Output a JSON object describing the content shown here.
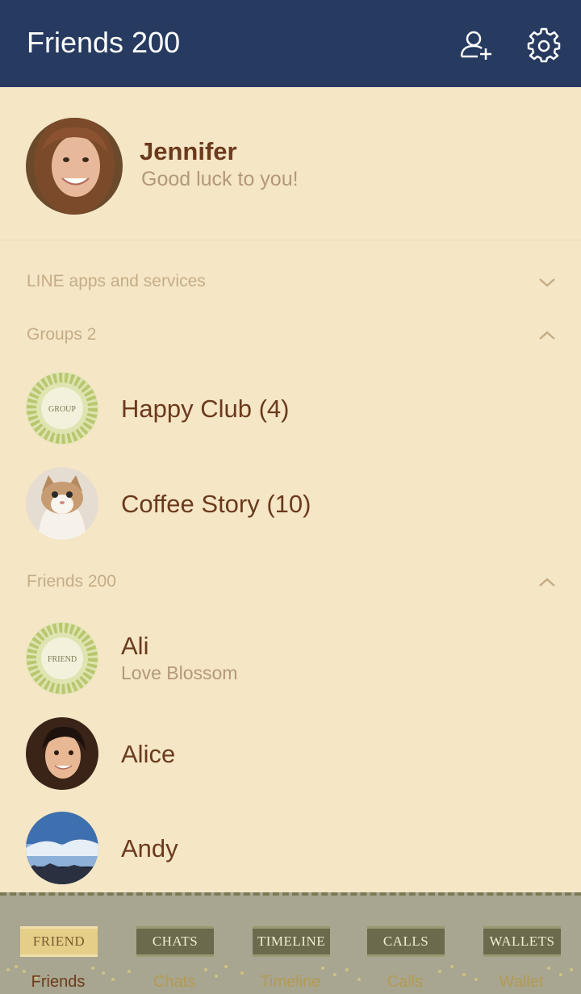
{
  "header": {
    "title": "Friends 200",
    "add_friend_icon": "add-friend-icon",
    "settings_icon": "gear-icon",
    "bg_color": "#273a60"
  },
  "profile": {
    "name": "Jennifer",
    "status": "Good luck to you!"
  },
  "sections": {
    "services": {
      "label": "LINE apps and services",
      "state": "collapsed"
    },
    "groups": {
      "label": "Groups 2",
      "state": "expanded"
    },
    "friends": {
      "label": "Friends 200",
      "state": "expanded"
    }
  },
  "groups": [
    {
      "name": "Happy Club (4)",
      "avatar_text": "GROUP"
    },
    {
      "name": "Coffee Story (10)"
    }
  ],
  "friends": [
    {
      "name": "Ali",
      "status": "Love Blossom",
      "avatar_text": "FRIEND"
    },
    {
      "name": "Alice"
    },
    {
      "name": "Andy"
    }
  ],
  "tabs": [
    {
      "plate": "FRIEND",
      "label": "Friends",
      "active": true
    },
    {
      "plate": "CHATS",
      "label": "Chats",
      "active": false
    },
    {
      "plate": "TIMELINE",
      "label": "Timeline",
      "active": false
    },
    {
      "plate": "CALLS",
      "label": "Calls",
      "active": false
    },
    {
      "plate": "WALLETS",
      "label": "Wallet",
      "active": false
    }
  ],
  "colors": {
    "background": "#f5e6c6",
    "name_text": "#6b3a1c",
    "secondary_text": "#b3987b",
    "section_text": "#c5ad86",
    "tabbar": "#a8a690"
  }
}
